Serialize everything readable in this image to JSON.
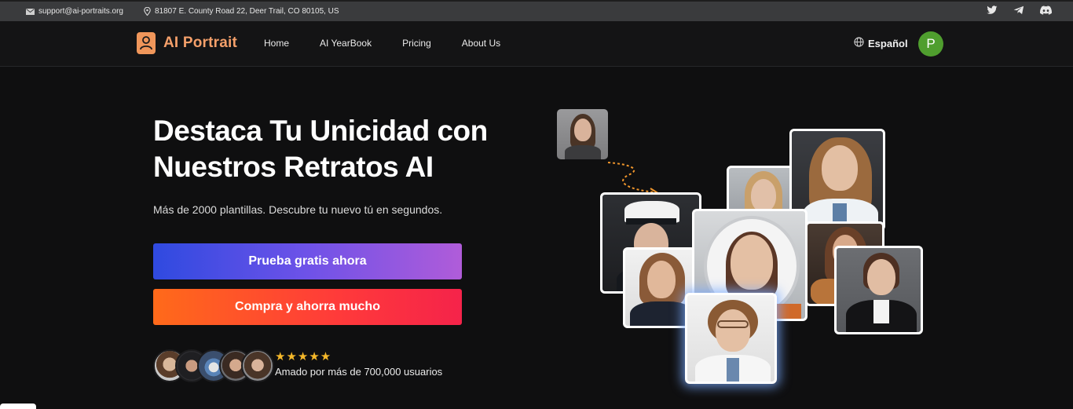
{
  "topbar": {
    "email": "support@ai-portraits.org",
    "address": "81807 E. County Road 22, Deer Trail, CO 80105, US",
    "socials": [
      "twitter-icon",
      "telegram-icon",
      "discord-icon"
    ]
  },
  "nav": {
    "brand": "AI Portrait",
    "links": [
      "Home",
      "AI YearBook",
      "Pricing",
      "About Us"
    ],
    "language": "Español",
    "avatar_initial": "P"
  },
  "hero": {
    "title_line1": "Destaca Tu Unicidad con",
    "title_line2": "Nuestros Retratos AI",
    "subtitle": "Más de 2000 plantillas. Descubre tu nuevo tú en segundos.",
    "cta_primary": "Prueba gratis ahora",
    "cta_secondary": "Compra y ahorra mucho",
    "stars": "★★★★★",
    "rating_count": 5,
    "social_proof": "Amado por más de 700,000 usuarios"
  },
  "colors": {
    "brand": "#f5a06a",
    "avatar_bg": "#4f9e2e",
    "star": "#f5b82a"
  }
}
